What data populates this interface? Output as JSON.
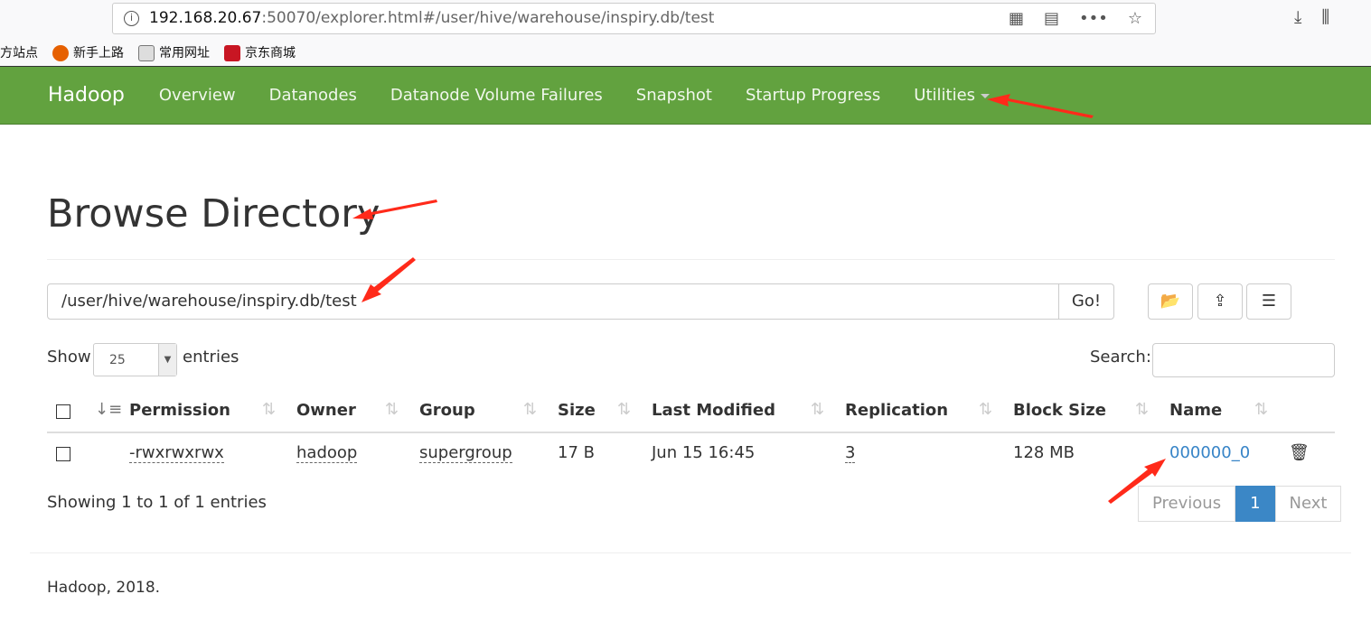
{
  "browser": {
    "url_host": "192.168.20.67",
    "url_rest": ":50070/explorer.html#/user/hive/warehouse/inspiry.db/test",
    "bookmarks": [
      "方站点",
      "新手上路",
      "常用网址",
      "京东商城"
    ]
  },
  "nav": {
    "brand": "Hadoop",
    "items": [
      "Overview",
      "Datanodes",
      "Datanode Volume Failures",
      "Snapshot",
      "Startup Progress",
      "Utilities"
    ]
  },
  "page": {
    "title": "Browse Directory",
    "path": "/user/hive/warehouse/inspiry.db/test",
    "go": "Go!",
    "show": "Show",
    "entries_value": "25",
    "entries": "entries",
    "search": "Search:",
    "columns": [
      "Permission",
      "Owner",
      "Group",
      "Size",
      "Last Modified",
      "Replication",
      "Block Size",
      "Name"
    ],
    "rows": [
      {
        "permission": "-rwxrwxrwx",
        "owner": "hadoop",
        "group": "supergroup",
        "size": "17 B",
        "modified": "Jun 15 16:45",
        "replication": "3",
        "block_size": "128 MB",
        "name": "000000_0"
      }
    ],
    "showing": "Showing 1 to 1 of 1 entries",
    "prev": "Previous",
    "page": "1",
    "next": "Next"
  },
  "footer": "Hadoop, 2018.",
  "colors": {
    "navbar": "#62a23f",
    "link": "#3784c7",
    "annotation": "#ff2a1a"
  }
}
